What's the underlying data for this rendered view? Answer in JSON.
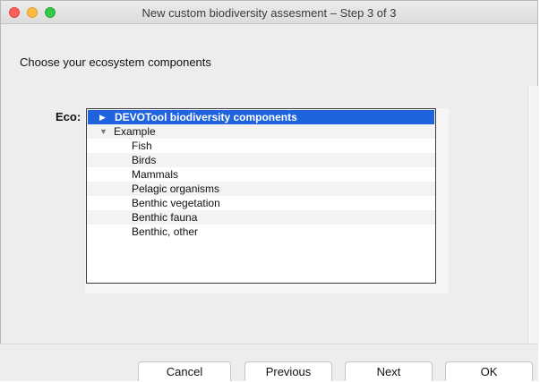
{
  "window": {
    "title": "New custom biodiversity assesment – Step 3 of 3"
  },
  "prompt": "Choose your ecosystem components",
  "eco": {
    "label": "Eco:",
    "tree": [
      {
        "label": "DEVOTool biodiversity components",
        "arrow": "▶",
        "level": 0,
        "selected": true,
        "alt": false
      },
      {
        "label": "Example",
        "arrow": "▼",
        "level": 0,
        "selected": false,
        "alt": true
      },
      {
        "label": "Fish",
        "level": 1,
        "selected": false,
        "alt": false
      },
      {
        "label": "Birds",
        "level": 1,
        "selected": false,
        "alt": true
      },
      {
        "label": "Mammals",
        "level": 1,
        "selected": false,
        "alt": false
      },
      {
        "label": "Pelagic organisms",
        "level": 1,
        "selected": false,
        "alt": true
      },
      {
        "label": "Benthic vegetation",
        "level": 1,
        "selected": false,
        "alt": false
      },
      {
        "label": "Benthic fauna",
        "level": 1,
        "selected": false,
        "alt": true
      },
      {
        "label": "Benthic, other",
        "level": 1,
        "selected": false,
        "alt": false
      }
    ]
  },
  "buttons": {
    "cancel": "Cancel",
    "previous": "Previous",
    "next": "Next",
    "ok": "OK"
  },
  "colors": {
    "selection": "#1f63de",
    "close": "#fc605c",
    "minimize": "#fdbc40",
    "maximize": "#34c84a"
  }
}
